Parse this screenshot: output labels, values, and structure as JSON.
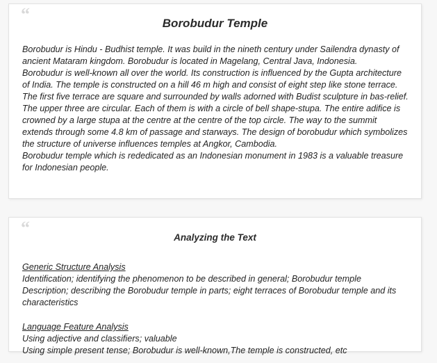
{
  "theme": {
    "page_background": "#f7f7f7",
    "card_background": "#ffffff",
    "card_border": "#e2e2e2",
    "text_color": "#232323",
    "title_color": "#2b2b2b",
    "quote_mark_color": "#d9d9d9"
  },
  "cards": [
    {
      "id": "borobudur-temple-card",
      "quote_icon": "“",
      "title": "Borobudur Temple",
      "paragraphs": [
        "Borobudur is Hindu - Budhist temple. It was build in the nineth century under Sailendra dynasty of ancient Mataram kingdom. Borobudur is located in Magelang, Central Java, Indonesia.",
        "Borobudur is well-known all over the world. Its construction is influenced by the Gupta architecture of India. The temple is constructed on a hill 46 m high and consist of eight step like stone terrace. The first five terrace are square and surrounded by walls adorned with Budist sculpture in bas-relief. The upper three are circular. Each of them is with a circle of bell shape-stupa. The entire adifice is crowned by a large stupa at the centre at the centre of the top circle. The way to the summit extends through some 4.8 km of passage and starways. The design of borobudur which symbolizes the structure of universe influences temples at Angkor, Cambodia.",
        "Borobudur temple which is rededicated as an Indonesian monument in 1983 is a valuable treasure for Indonesian people."
      ]
    },
    {
      "id": "analyzing-the-text-card",
      "quote_icon": "“",
      "title": "Analyzing the Text",
      "sections": [
        {
          "heading": "Generic Structure Analysis",
          "lines": [
            "Identification; identifying the phenomenon to be described in general; Borobudur temple",
            "Description; describing the Borobudur temple in parts; eight terraces of Borobudur temple and its characteristics"
          ]
        },
        {
          "heading": "Language Feature Analysis",
          "lines": [
            "Using adjective and classifiers; valuable",
            "Using simple present tense; Borobudur is well-known,The temple is constructed, etc"
          ]
        }
      ]
    }
  ]
}
